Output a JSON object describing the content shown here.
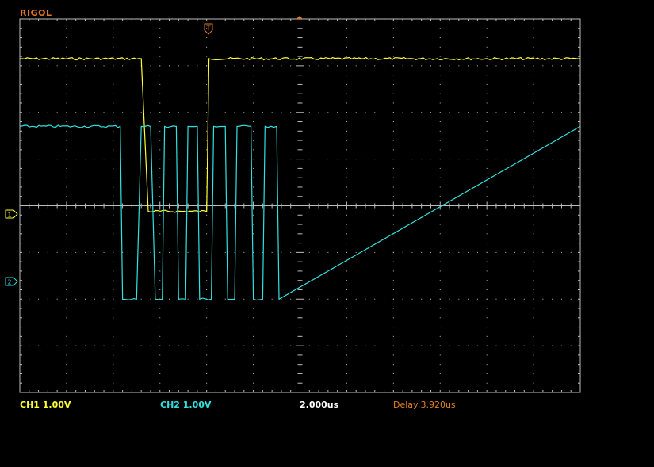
{
  "brand": "RIGOL",
  "colors": {
    "background": "#000000",
    "grid": "#bdbdbd",
    "ch1": "#ffff33",
    "ch2": "#33e0e0",
    "brand": "#e07828",
    "trigger": "#e07828",
    "status_white": "#ffffff",
    "delay": "#e08020"
  },
  "icons": {
    "trigger_marker": "T-trigger-marker-icon",
    "ch1_marker": "ch1-ground-marker-icon",
    "ch2_marker": "ch2-ground-marker-icon",
    "trigger_level": "trigger-level-icon"
  },
  "screen": {
    "divisions_x": 12,
    "divisions_y": 8
  },
  "markers": {
    "trigger_label": "T",
    "ch1_label": "1",
    "ch2_label": "2"
  },
  "status": {
    "ch1": "CH1 1.00V",
    "ch2": "CH2 1.00V",
    "timebase": "2.000us",
    "delay": "Delay:3.920us"
  },
  "chart_data": {
    "type": "line",
    "title": "",
    "xlabel": "",
    "ylabel": "",
    "x_unit": "div",
    "y_unit": "div",
    "xlim": [
      -6,
      6
    ],
    "ylim": [
      -4,
      4
    ],
    "grid": true,
    "series": [
      {
        "name": "",
        "color": "#ffff33",
        "x": [
          -6.0,
          -3.4,
          -3.25,
          -2.0,
          -1.95,
          6.0
        ],
        "y": [
          3.15,
          3.15,
          -0.12,
          -0.12,
          3.15,
          3.15
        ]
      },
      {
        "name": "",
        "color": "#33e0e0",
        "x": [
          -6.0,
          -3.85,
          -3.8,
          -3.5,
          -3.4,
          -3.2,
          -3.1,
          -2.95,
          -2.9,
          -2.65,
          -2.6,
          -2.45,
          -2.4,
          -2.2,
          -2.15,
          -1.9,
          -1.85,
          -1.6,
          -1.55,
          -1.4,
          -1.35,
          -1.05,
          -1.0,
          -0.8,
          -0.75,
          -0.5,
          -0.45,
          6.0
        ],
        "y": [
          1.7,
          1.7,
          -2.0,
          -2.0,
          1.7,
          1.7,
          -2.0,
          -2.0,
          1.7,
          1.7,
          -2.0,
          -2.0,
          1.7,
          1.7,
          -2.0,
          -2.0,
          1.7,
          1.7,
          -2.0,
          -2.0,
          1.7,
          1.7,
          -2.0,
          -2.0,
          1.7,
          1.7,
          -2.0,
          1.7
        ]
      }
    ]
  }
}
